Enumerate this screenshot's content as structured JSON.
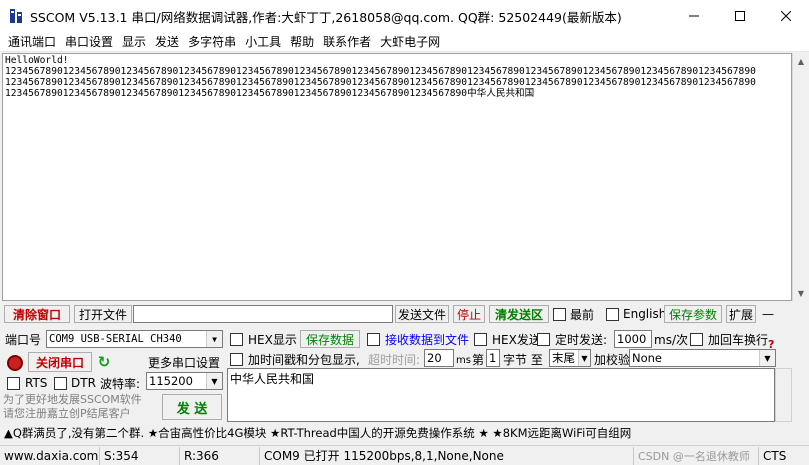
{
  "window": {
    "title": "SSCOM V5.13.1 串口/网络数据调试器,作者:大虾丁丁,2618058@qq.com. QQ群: 52502449(最新版本)"
  },
  "menu": {
    "items": [
      "通讯端口",
      "串口设置",
      "显示",
      "发送",
      "多字符串",
      "小工具",
      "帮助",
      "联系作者",
      "大虾电子网"
    ]
  },
  "receive": {
    "lines": [
      "HelloWorld!",
      "1234567890123456789012345678901234567890123456789012345678901234567890123456789012345678901234567890123456789012345678901234567890",
      "1234567890123456789012345678901234567890123456789012345678901234567890123456789012345678901234567890123456789012345678901234567890",
      "12345678901234567890123456789012345678901234567890123456789012345678901234567890中华人民共和国"
    ]
  },
  "row1": {
    "clear_window": "清除窗口",
    "open_file": "打开文件",
    "file_path": "",
    "send_file": "发送文件",
    "stop": "停止",
    "clear_send": "清发送区",
    "topmost": "最前",
    "english": "English",
    "save_params": "保存参数",
    "expand": "扩展",
    "collapse": "—"
  },
  "port": {
    "port_label": "端口号",
    "port_value": "COM9 USB-SERIAL CH340",
    "close_port": "关闭串口",
    "more_settings": "更多串口设置",
    "rts": "RTS",
    "dtr": "DTR",
    "baud_label": "波特率:",
    "baud_value": "115200"
  },
  "options": {
    "hex_display": "HEX显示",
    "save_data": "保存数据",
    "recv_to_file": "接收数据到文件",
    "hex_send": "HEX发送",
    "timed_send": "定时发送:",
    "interval_value": "1000",
    "interval_unit": "ms/次",
    "add_crlf": "加回车换行",
    "timestamp": "加时间戳和分包显示,",
    "timeout_label": "超时时间:",
    "timeout_value": "20",
    "timeout_unit": "ms",
    "byte_prefix": "第",
    "byte_value": "1",
    "byte_suffix": "字节 至",
    "end_value": "末尾",
    "checksum_label": "加校验",
    "checksum_value": "None"
  },
  "send": {
    "text": "中华人民共和国",
    "send_button": "发  送",
    "register_note": "为了更好地发展SSCOM软件\n请您注册嘉立创P结尾客户"
  },
  "promo": {
    "text": "▲Q群满员了,没有第二个群. ★合宙高性价比4G模块 ★RT-Thread中国人的开源免费操作系统 ★ ★8KM远距离WiFi可自组网"
  },
  "status": {
    "website": "www.daxia.com",
    "sent": "S:354",
    "received": "R:366",
    "port_status": "COM9 已打开  115200bps,8,1,None,None",
    "watermark": "CSDN @一名退休教师",
    "cts": "CTS"
  }
}
